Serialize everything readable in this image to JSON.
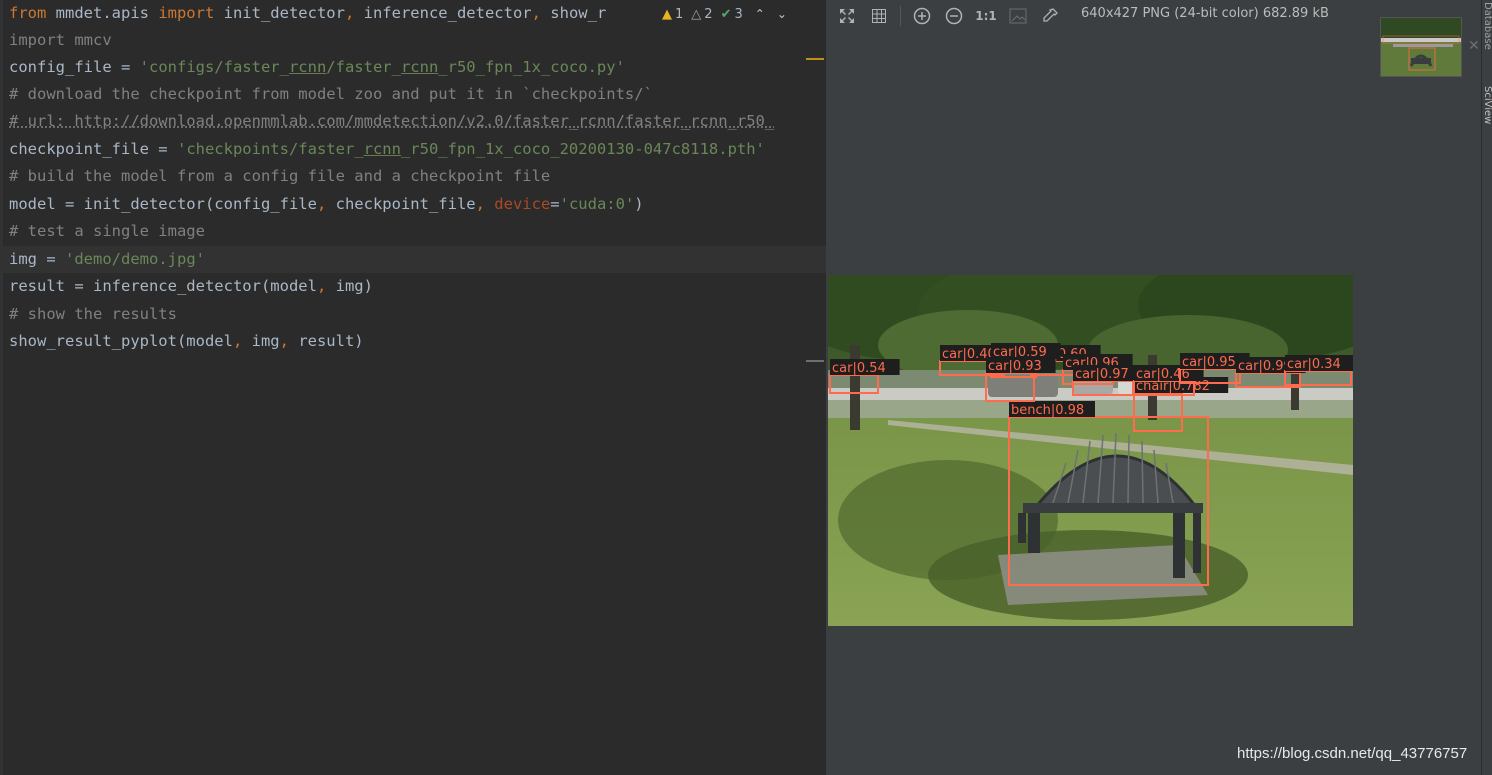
{
  "editor": {
    "lines": [
      {
        "segments": [
          {
            "t": "from",
            "c": "kw"
          },
          {
            "t": " mmdet.apis ",
            "c": ""
          },
          {
            "t": "import",
            "c": "kw"
          },
          {
            "t": " init_detector",
            "c": ""
          },
          {
            "t": ",",
            "c": "sym"
          },
          {
            "t": " inference_detector",
            "c": ""
          },
          {
            "t": ",",
            "c": "sym"
          },
          {
            "t": " show_r",
            "c": ""
          }
        ]
      },
      {
        "segments": [
          {
            "t": "import mmcv",
            "c": "muted"
          }
        ]
      },
      {
        "segments": [
          {
            "t": "config_file = ",
            "c": ""
          },
          {
            "t": "'configs/faster_",
            "c": "str"
          },
          {
            "t": "rcnn",
            "c": "str ul"
          },
          {
            "t": "/faster_",
            "c": "str"
          },
          {
            "t": "rcnn",
            "c": "str ul"
          },
          {
            "t": "_r50_fpn_1x_coco.py'",
            "c": "str"
          }
        ]
      },
      {
        "segments": [
          {
            "t": "# download the checkpoint from model zoo and put it in `checkpoints/`",
            "c": "cm"
          }
        ]
      },
      {
        "segments": [
          {
            "t": "# url: http://download.openmmlab.com/mmdetection/v2.0/faster_rcnn/faster_rcnn_r50_",
            "c": "cm-ul"
          }
        ]
      },
      {
        "segments": [
          {
            "t": "checkpoint_file = ",
            "c": ""
          },
          {
            "t": "'checkpoints/faster_",
            "c": "str"
          },
          {
            "t": "rcnn",
            "c": "str ul"
          },
          {
            "t": "_r50_fpn_1x_coco_20200130-047c8118.pth'",
            "c": "str"
          }
        ]
      },
      {
        "segments": [
          {
            "t": "# build the model from a config file and a checkpoint file",
            "c": "cm"
          }
        ]
      },
      {
        "segments": [
          {
            "t": "model = init_detector(config_file",
            "c": ""
          },
          {
            "t": ",",
            "c": "sym"
          },
          {
            "t": " checkpoint_file",
            "c": ""
          },
          {
            "t": ",",
            "c": "sym"
          },
          {
            "t": " ",
            "c": ""
          },
          {
            "t": "device",
            "c": "param"
          },
          {
            "t": "=",
            "c": ""
          },
          {
            "t": "'cuda:0'",
            "c": "str"
          },
          {
            "t": ")",
            "c": ""
          }
        ]
      },
      {
        "segments": [
          {
            "t": "# test a single image",
            "c": "cm"
          }
        ]
      },
      {
        "segments": [
          {
            "t": "img = ",
            "c": ""
          },
          {
            "t": "'demo/demo.jpg'",
            "c": "str"
          }
        ]
      },
      {
        "segments": [
          {
            "t": "result = inference_detector(model",
            "c": ""
          },
          {
            "t": ",",
            "c": "sym"
          },
          {
            "t": " img)",
            "c": ""
          }
        ]
      },
      {
        "segments": [
          {
            "t": "# show the results",
            "c": "cm"
          }
        ]
      },
      {
        "segments": [
          {
            "t": "show_result_pyplot(model",
            "c": ""
          },
          {
            "t": ",",
            "c": "sym"
          },
          {
            "t": " img",
            "c": ""
          },
          {
            "t": ",",
            "c": "sym"
          },
          {
            "t": " result)",
            "c": ""
          }
        ]
      }
    ],
    "inspections": {
      "warnings": "1",
      "weak_warnings": "2",
      "typos": "3"
    }
  },
  "viewer": {
    "image_info": "640x427 PNG (24-bit color) 682.89 kB",
    "actual_size_label": "1:1",
    "detections": [
      {
        "label": "bench|0.98"
      },
      {
        "label": "chair|0.782"
      },
      {
        "label": "car|0.54"
      },
      {
        "label": "car|0.40"
      },
      {
        "label": "car|0.60"
      },
      {
        "label": "car|0.96"
      },
      {
        "label": "car|0.97"
      },
      {
        "label": "car|0.46"
      },
      {
        "label": "car|0.95"
      },
      {
        "label": "car|0.99"
      },
      {
        "label": "car|0.34"
      },
      {
        "label": "car|0.59"
      },
      {
        "label": "car|0.93"
      }
    ]
  },
  "side_strip": {
    "top_label": "Database",
    "sciview_label": "SciView"
  },
  "watermark": "https://blog.csdn.net/qq_43776757"
}
